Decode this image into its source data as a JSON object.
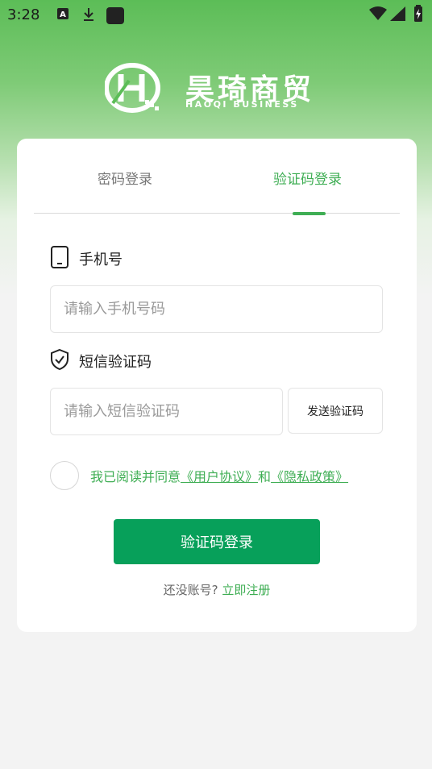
{
  "status_bar": {
    "time": "3:28",
    "icons": [
      "a-badge-icon",
      "download-icon",
      "app-square-icon",
      "wifi-icon",
      "signal-icon",
      "battery-charging-icon"
    ]
  },
  "brand": {
    "title": "昊琦商贸",
    "subtitle": "HAOQI BUSINESS"
  },
  "tabs": [
    {
      "label": "密码登录",
      "active": false
    },
    {
      "label": "验证码登录",
      "active": true
    }
  ],
  "phone": {
    "label": "手机号",
    "placeholder": "请输入手机号码",
    "value": ""
  },
  "sms": {
    "label": "短信验证码",
    "placeholder": "请输入短信验证码",
    "value": "",
    "send_label": "发送验证码"
  },
  "agreement": {
    "prefix": "我已阅读并同意",
    "user_agreement": "《用户协议》",
    "conjunction": "和",
    "privacy_policy": "《隐私政策》",
    "checked": false
  },
  "login_button": "验证码登录",
  "register": {
    "question": "还没账号?",
    "link": "立即注册"
  },
  "colors": {
    "accent": "#3fae54",
    "button": "#07a05a",
    "header_green": "#5cbd57"
  }
}
